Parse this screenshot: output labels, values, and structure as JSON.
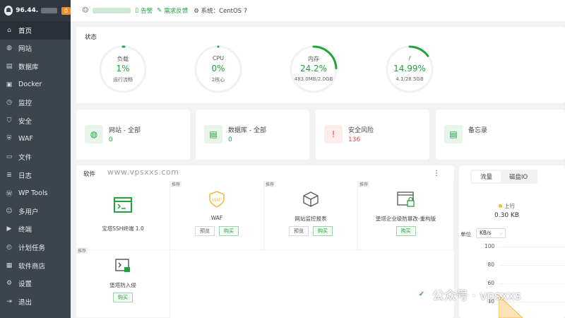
{
  "sidebar": {
    "ip": "96.44.",
    "badge": "0",
    "items": [
      {
        "label": "首页",
        "icon": "home-icon",
        "glyph": "⌂",
        "active": true
      },
      {
        "label": "网站",
        "icon": "globe-icon",
        "glyph": "◍"
      },
      {
        "label": "数据库",
        "icon": "database-icon",
        "glyph": "▤"
      },
      {
        "label": "Docker",
        "icon": "docker-icon",
        "glyph": "▣"
      },
      {
        "label": "监控",
        "icon": "monitor-icon",
        "glyph": "◷"
      },
      {
        "label": "安全",
        "icon": "shield-icon",
        "glyph": "⛉"
      },
      {
        "label": "WAF",
        "icon": "waf-icon",
        "glyph": "⛨"
      },
      {
        "label": "文件",
        "icon": "folder-icon",
        "glyph": "▭"
      },
      {
        "label": "日志",
        "icon": "log-icon",
        "glyph": "≣"
      },
      {
        "label": "WP Tools",
        "icon": "wordpress-icon",
        "glyph": "Ⓦ"
      },
      {
        "label": "多用户",
        "icon": "users-icon",
        "glyph": "☺"
      },
      {
        "label": "终端",
        "icon": "terminal-icon",
        "glyph": "▶"
      },
      {
        "label": "计划任务",
        "icon": "clock-icon",
        "glyph": "◴"
      },
      {
        "label": "软件商店",
        "icon": "store-icon",
        "glyph": "▦"
      },
      {
        "label": "设置",
        "icon": "gear-icon",
        "glyph": "⚙"
      },
      {
        "label": "退出",
        "icon": "logout-icon",
        "glyph": "⇥"
      }
    ]
  },
  "topbar": {
    "alert": "告警",
    "feedback": "需求反馈",
    "system": "系统：CentOS 7"
  },
  "status": {
    "title": "状态",
    "gauges": [
      {
        "label": "负载",
        "value": "1%",
        "sub": "运行流畅",
        "percent": 1
      },
      {
        "label": "CPU",
        "value": "0%",
        "sub": "2核心",
        "percent": 0
      },
      {
        "label": "内存",
        "value": "24.2%",
        "sub": "483.0MB/2.0GB",
        "percent": 24.2
      },
      {
        "label": "/",
        "value": "14.99%",
        "sub": "4.1/28.5GB",
        "percent": 14.99
      }
    ]
  },
  "cards": [
    {
      "title": "网站 - 全部",
      "value": "0",
      "icon": "globe-icon",
      "glyph": "◍",
      "iconColor": "#20a53a",
      "valueColor": "#20a53a"
    },
    {
      "title": "数据库 - 全部",
      "value": "0",
      "icon": "database-icon",
      "glyph": "▤",
      "iconColor": "#20a53a",
      "valueColor": "#20a53a"
    },
    {
      "title": "安全风险",
      "value": "136",
      "icon": "shield-alert-icon",
      "glyph": "!",
      "iconColor": "#e5483a",
      "valueColor": "#e5483a"
    },
    {
      "title": "备忘录",
      "value": "",
      "icon": "memo-icon",
      "glyph": "▤",
      "iconColor": "#20a53a",
      "valueColor": "#20a53a"
    }
  ],
  "software": {
    "title": "软件",
    "watermark": "www.vpsxxs.com",
    "tiles": [
      {
        "name": "宝塔SSH终端 1.0",
        "tag": "",
        "icon": "ssh-terminal-icon",
        "preview": "",
        "buy": ""
      },
      {
        "name": "WAF",
        "tag": "推荐",
        "icon": "waf-shield-icon",
        "preview": "预览",
        "buy": "购买"
      },
      {
        "name": "网站监控报表",
        "tag": "推荐",
        "icon": "cube-icon",
        "preview": "预览",
        "buy": "购买"
      },
      {
        "name": "堡塔企业级防篡改-重构版",
        "tag": "推荐",
        "icon": "lock-window-icon",
        "preview": "",
        "buy": "购买"
      },
      {
        "name": "堡塔防入侵",
        "tag": "推荐",
        "icon": "intrusion-icon",
        "preview": "",
        "buy": "购买"
      }
    ]
  },
  "traffic": {
    "tabs": [
      "流量",
      "磁盘IO"
    ],
    "legend": "上行",
    "up_value": "0.30 KB",
    "unit_label": "单位",
    "unit_value": "KB/s",
    "yticks": [
      "100",
      "80",
      "60",
      "40"
    ]
  },
  "watermark2": "公众号 · vpsxxs"
}
